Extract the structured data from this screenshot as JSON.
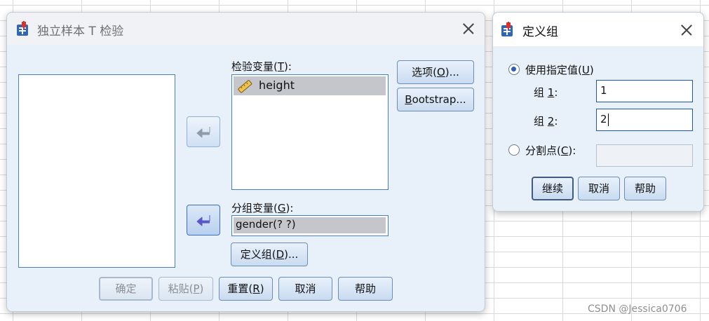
{
  "main_dialog": {
    "title": "独立样本 T 检验",
    "test_variables_label": "检验变量(",
    "test_variables_mnemonic": "T",
    "test_variables_suffix": "):",
    "test_variables": [
      "height"
    ],
    "grouping_label": "分组变量(",
    "grouping_mnemonic": "G",
    "grouping_suffix": "):",
    "grouping_value": "gender(? ?)",
    "buttons": {
      "options_prefix": "选项(",
      "options_mnemonic": "O",
      "options_suffix": ")...",
      "bootstrap_mnemonic": "B",
      "bootstrap_rest": "ootstrap...",
      "define_groups_prefix": "定义组(",
      "define_groups_mnemonic": "D",
      "define_groups_suffix": ")...",
      "ok": "确定",
      "paste_prefix": "粘贴(",
      "paste_mnemonic": "P",
      "paste_suffix": ")",
      "reset_prefix": "重置(",
      "reset_mnemonic": "R",
      "reset_suffix": ")",
      "cancel": "取消",
      "help": "帮助"
    }
  },
  "define_groups_dialog": {
    "title": "定义组",
    "use_specified_prefix": "使用指定值(",
    "use_specified_mnemonic": "U",
    "use_specified_suffix": ")",
    "group1_prefix": "组 ",
    "group1_mnemonic": "1",
    "group1_suffix": ":",
    "group1_value": "1",
    "group2_prefix": "组 ",
    "group2_mnemonic": "2",
    "group2_suffix": ":",
    "group2_value": "2",
    "cut_point_prefix": "分割点(",
    "cut_point_mnemonic": "C",
    "cut_point_suffix": "):",
    "cut_point_value": "",
    "buttons": {
      "continue": "继续",
      "cancel": "取消",
      "help": "帮助"
    }
  },
  "watermark": "CSDN @Jessica0706",
  "colors": {
    "accent": "#2c5fb1",
    "dialog_bg": "#e8f0f9",
    "arrow": "#5a57c9"
  }
}
